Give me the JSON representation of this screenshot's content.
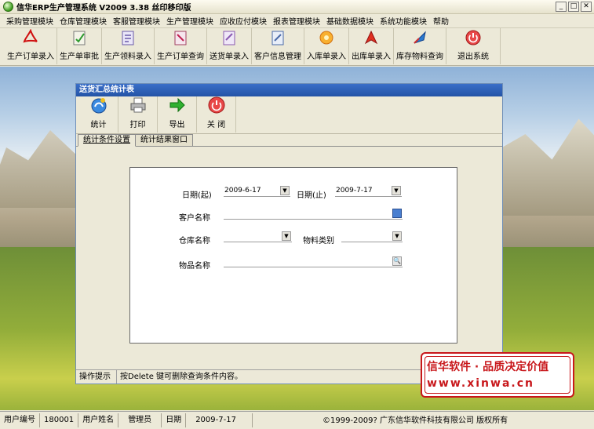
{
  "window": {
    "title": "信华ERP生产管理系统 V2009 3.38 丝印移印版",
    "min_symbol": "_",
    "max_symbol": "□",
    "close_symbol": "✕"
  },
  "menu": [
    "采购管理模块",
    "仓库管理模块",
    "客服管理模块",
    "生产管理模块",
    "应收应付模块",
    "报表管理模块",
    "基础数据模块",
    "系统功能模块",
    "帮助"
  ],
  "toolbar": [
    {
      "label": "生产订单录入",
      "icon": "pdf-icon"
    },
    {
      "label": "生产单审批",
      "icon": "approve-icon"
    },
    {
      "label": "生产领料录入",
      "icon": "material-icon"
    },
    {
      "label": "生产订单查询",
      "icon": "query-icon"
    },
    {
      "label": "送货单录入",
      "icon": "delivery-icon"
    },
    {
      "label": "客户信息管理",
      "icon": "customer-icon"
    },
    {
      "label": "入库单录入",
      "icon": "stock-in-icon"
    },
    {
      "label": "出库单录入",
      "icon": "stock-out-icon"
    },
    {
      "label": "库存物料查询",
      "icon": "inventory-icon"
    },
    {
      "label": "退出系统",
      "icon": "power-icon"
    }
  ],
  "child": {
    "title": "送货汇总统计表",
    "buttons": [
      {
        "label": "统计"
      },
      {
        "label": "打印"
      },
      {
        "label": "导出"
      },
      {
        "label": "关 闭"
      }
    ],
    "tabs": [
      "统计条件设置",
      "统计结果窗口"
    ],
    "form": {
      "date_from_label": "日期(起)",
      "date_from_value": "2009-6-17",
      "date_to_label": "日期(止)",
      "date_to_value": "2009-7-17",
      "customer_label": "客户名称",
      "customer_value": "",
      "warehouse_label": "仓库名称",
      "warehouse_value": "",
      "category_label": "物料类别",
      "category_value": "",
      "item_label": "物品名称",
      "item_value": "",
      "dropdown_arrow": "▼",
      "search_glyph": "🔍"
    },
    "hint_label": "操作提示",
    "hint_text": "按Delete 键可删除查询条件内容。"
  },
  "promo": {
    "line1": "信华软件 · 品质决定价值",
    "line2": "www.xinwa.cn"
  },
  "status": {
    "user_id_label": "用户编号",
    "user_id": "180001",
    "user_name_label": "用户姓名",
    "user_name": "管理员",
    "date_label": "日期",
    "date": "2009-7-17",
    "copyright": "©1999-2009?  广东信华软件科技有限公司  版权所有"
  },
  "colors": {
    "child_title": "#2453a6",
    "promo_red": "#c8171b"
  }
}
